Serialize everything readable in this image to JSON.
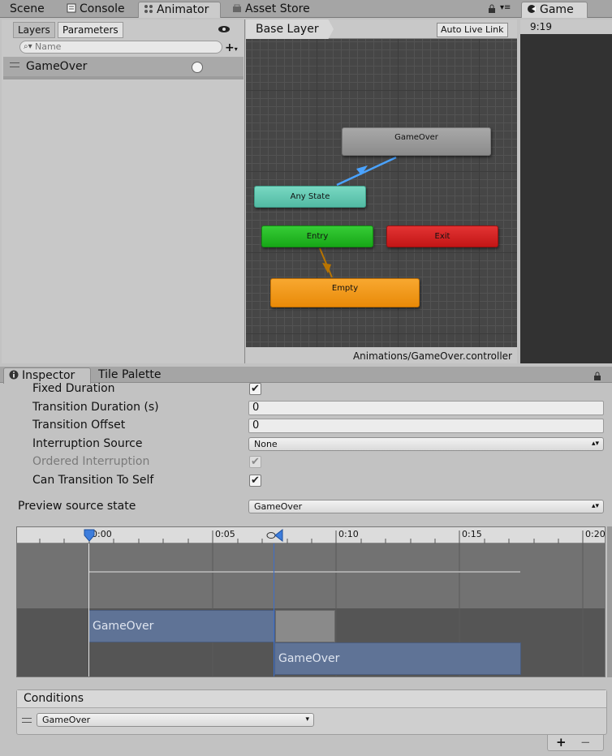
{
  "top_tabs": [
    {
      "label": "Scene"
    },
    {
      "label": "Console"
    },
    {
      "label": "Animator"
    },
    {
      "label": "Asset Store"
    }
  ],
  "game_tab": {
    "label": "Game",
    "resolution": "9:19"
  },
  "animator": {
    "tabs": {
      "layers": "Layers",
      "parameters": "Parameters"
    },
    "search_placeholder": "Name",
    "parameter": {
      "name": "GameOver",
      "type": "trigger"
    },
    "breadcrumb": "Base Layer",
    "auto_live_link": "Auto Live Link",
    "footer_path": "Animations/GameOver.controller",
    "nodes": {
      "gameover": "GameOver",
      "anystate": "Any State",
      "entry": "Entry",
      "exit": "Exit",
      "empty": "Empty"
    },
    "colors": {
      "gameover": "#9a9a9a",
      "anystate": "#5fc7b0",
      "entry": "#1fb51f",
      "exit": "#cf1e1e",
      "empty": "#f0900f",
      "transition_blue": "#4aa3ff",
      "transition_amber": "#b87400"
    }
  },
  "inspector": {
    "tabs": {
      "inspector": "Inspector",
      "tile_palette": "Tile Palette"
    },
    "fixed_duration": {
      "label": "Fixed Duration",
      "checked": true
    },
    "transition_duration": {
      "label": "Transition Duration (s)",
      "value": "0"
    },
    "transition_offset": {
      "label": "Transition Offset",
      "value": "0"
    },
    "interruption_source": {
      "label": "Interruption Source",
      "value": "None"
    },
    "ordered_interruption": {
      "label": "Ordered Interruption",
      "checked": true
    },
    "can_transition_to_self": {
      "label": "Can Transition To Self",
      "checked": true
    },
    "preview_source_state": {
      "label": "Preview source state",
      "value": "GameOver"
    },
    "timeline": {
      "ticks": [
        "0:00",
        "0:05",
        "0:10",
        "0:15",
        "0:20"
      ],
      "clip_from": "GameOver",
      "clip_to": "GameOver"
    },
    "conditions": {
      "title": "Conditions",
      "condition_value": "GameOver",
      "add": "+",
      "remove": "−"
    }
  }
}
